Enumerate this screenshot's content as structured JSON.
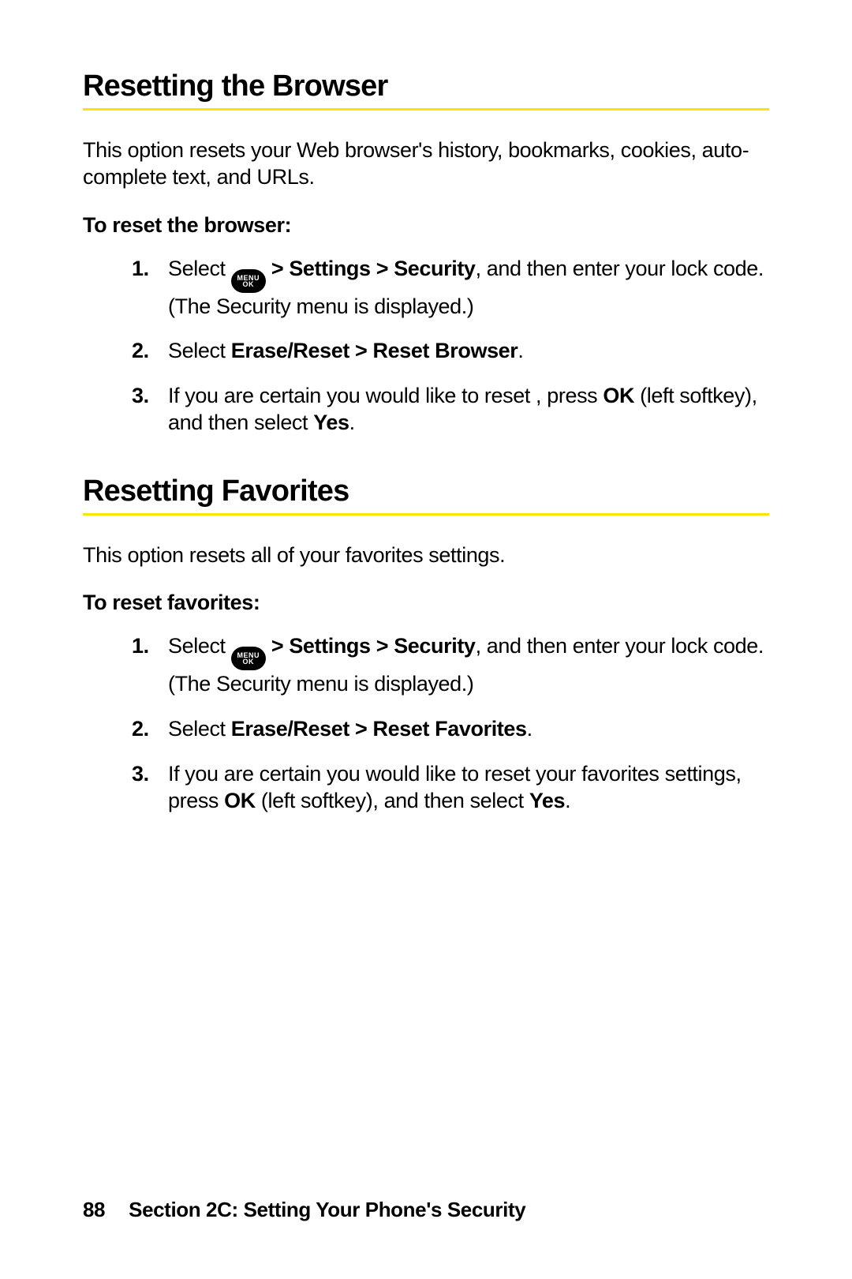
{
  "section1": {
    "heading": "Resetting the Browser",
    "intro": "This option resets your Web browser's history, bookmarks, cookies, auto-complete text, and URLs.",
    "subhead": "To reset the browser:",
    "step1_a": "Select ",
    "step1_nav": " > Settings > Security",
    "step1_b": ", and then enter your lock code. (The Security menu is displayed.)",
    "step2_a": "Select ",
    "step2_b": "Erase/Reset > Reset Browser",
    "step2_c": ".",
    "step3_a": "If you are certain you would like to reset , press ",
    "step3_ok": "OK",
    "step3_b": " (left softkey), and then select ",
    "step3_yes": "Yes",
    "step3_c": "."
  },
  "section2": {
    "heading": "Resetting Favorites",
    "intro": "This option resets all of your favorites settings.",
    "subhead": "To reset favorites:",
    "step1_a": "Select ",
    "step1_nav": " > Settings > Security",
    "step1_b": ", and then enter your lock code. (The Security menu is displayed.)",
    "step2_a": "Select ",
    "step2_b": "Erase/Reset > Reset Favorites",
    "step2_c": ".",
    "step3_a": "If you are certain you would like to reset your favorites settings, press ",
    "step3_ok": "OK",
    "step3_b": " (left softkey), and then select ",
    "step3_yes": "Yes",
    "step3_c": "."
  },
  "icon": {
    "line1": "MENU",
    "line2": "OK"
  },
  "footer": {
    "page": "88",
    "section": "Section 2C: Setting Your Phone's Security"
  }
}
